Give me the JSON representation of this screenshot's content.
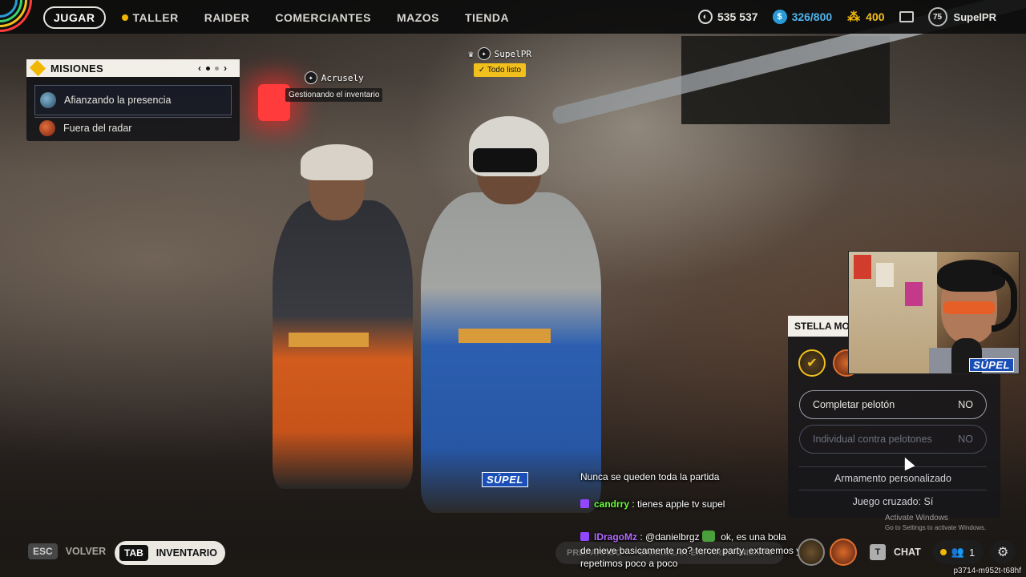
{
  "topbar": {
    "nav": [
      {
        "label": "JUGAR",
        "active": true
      },
      {
        "label": "TALLER",
        "active": false
      },
      {
        "label": "RAIDER",
        "active": false
      },
      {
        "label": "COMERCIANTES",
        "active": false
      },
      {
        "label": "MAZOS",
        "active": false
      },
      {
        "label": "TIENDA",
        "active": false
      }
    ],
    "coins": "535 537",
    "tokens": "326/800",
    "raider_tokens": "400",
    "level": "75",
    "username": "SupelPR"
  },
  "missions": {
    "title": "MISIONES",
    "items": [
      "Afianzando la presencia",
      "Fuera del radar"
    ]
  },
  "players": {
    "p1": {
      "name": "SupelPR",
      "status": "Todo listo"
    },
    "p2": {
      "name": "Acrusely",
      "status": "Gestionando el inventario"
    }
  },
  "party": {
    "title": "STELLA MO",
    "options": [
      {
        "label": "Completar pelotón",
        "value": "NO"
      },
      {
        "label": "Individual contra pelotones",
        "value": "NO"
      }
    ],
    "loadout": "Armamento personalizado",
    "crossplay": "Juego cruzado: Sí"
  },
  "watermark": {
    "line1": "Activate Windows",
    "line2": "Go to Settings to activate Windows."
  },
  "chat": {
    "messages": [
      {
        "user": "",
        "text": "Nunca se queden toda la partida"
      },
      {
        "user": "candrry",
        "text": ": tienes apple tv supel"
      },
      {
        "user": "IDragoMz",
        "text": ": @danielbrgz",
        "text2": " ok, es una bola",
        "line2": "de nieve basicamente no? tercer party, extraemos y",
        "line3": "repetimos poco a poco"
      }
    ]
  },
  "stream_logo": "SÚPEL",
  "bottom": {
    "back_key": "ESC",
    "back_label": "VOLVER",
    "inv_key": "TAB",
    "inv_label": "INVENTARIO",
    "faded1": "PREPARADO",
    "faded2": "CANCELAR EMPAREJAMIENTO",
    "t_key": "T",
    "chat_label": "CHAT",
    "party_count": "1",
    "session_id": "p3714-m952t-t68hf"
  },
  "colors": {
    "accent_gold": "#f2c01c",
    "token_blue": "#4eb5ee",
    "twitch_purple": "#9146ff"
  }
}
